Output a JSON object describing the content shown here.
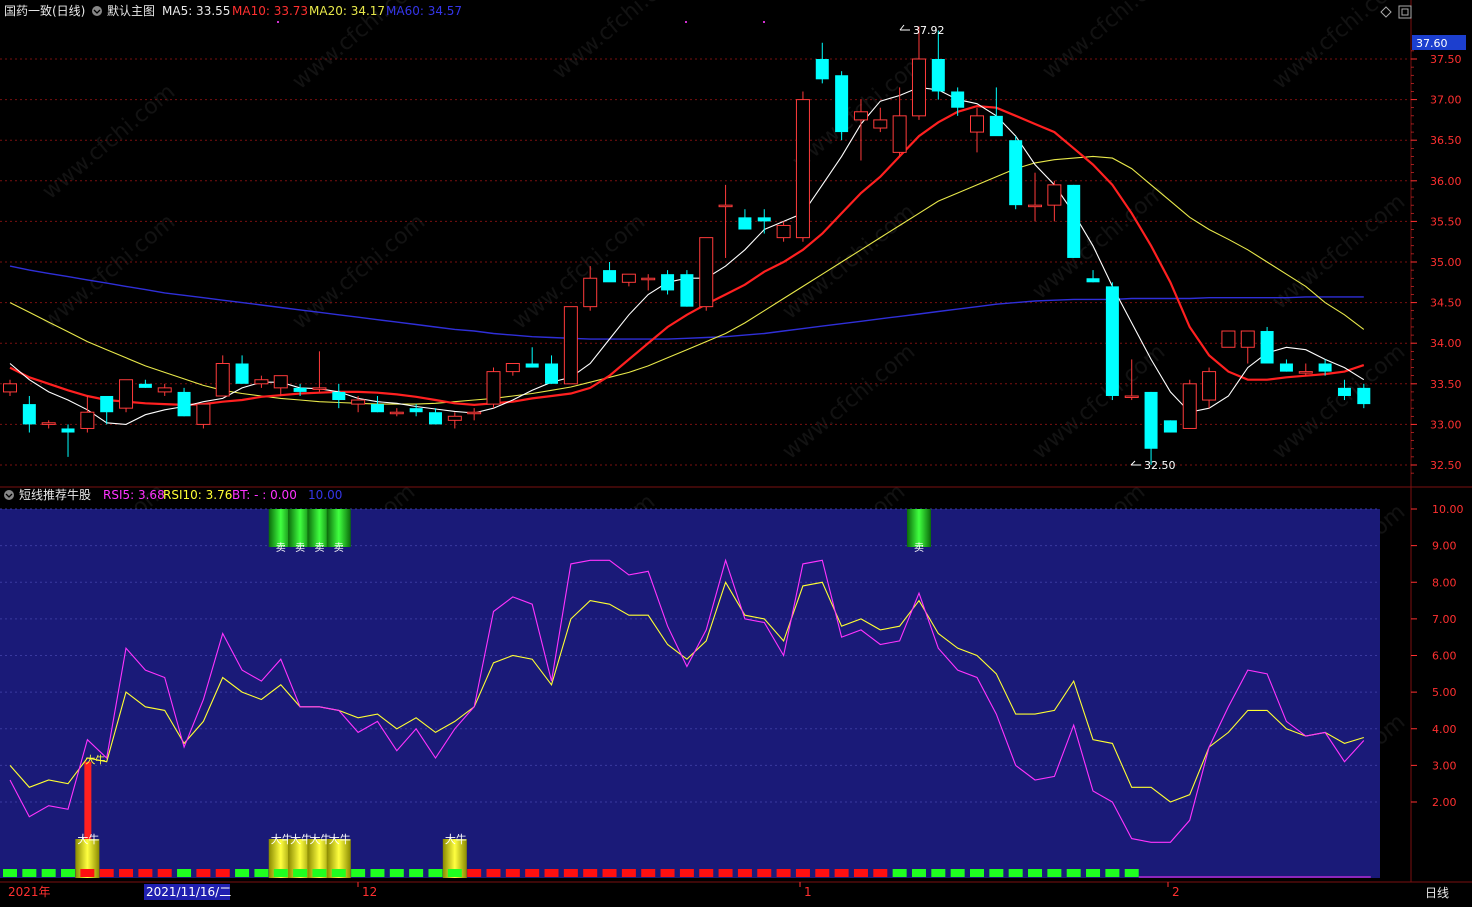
{
  "main_header": {
    "stock": "国药一致(日线)",
    "template": "默认主图",
    "ma5": "MA5: 33.55",
    "ma10": "MA10: 33.73",
    "ma20": "MA20: 34.17",
    "ma60": "MA60: 34.57"
  },
  "sub_header": {
    "indicator": "短线推荐牛股",
    "rsi5": "RSI5: 3.68",
    "rsi10": "RSI10: 3.76",
    "bt": "BT: - : 0.00",
    "ten": "10.00"
  },
  "price_label": "37.60",
  "high_marker": "37.92",
  "low_marker": "32.50",
  "bottom_axis": {
    "year": "2021年",
    "selected_date": "2021/11/16/二",
    "m12": "12",
    "m1": "1",
    "m2": "2",
    "period": "日线"
  },
  "signal_labels": {
    "sell": "卖",
    "bull": "大牛"
  },
  "watermark": "www.cfchi.com",
  "colors": {
    "up": "#ff3b3b",
    "down": "#00ffff",
    "ma5": "#ffffff",
    "ma10": "#ff2020",
    "ma20": "#e8e84a",
    "ma60": "#2f2fd8",
    "rsi5": "#ff33ff",
    "rsi10": "#ffff33",
    "panel_bg": "#1a1a78"
  },
  "chart_data": [
    {
      "type": "candlestick",
      "title": "国药一致(日线)",
      "ylim": [
        32.35,
        37.75
      ],
      "yticks": [
        32.5,
        33.0,
        33.5,
        34.0,
        34.5,
        35.0,
        35.5,
        36.0,
        36.5,
        37.0,
        37.5
      ],
      "ohlc": [
        [
          33.4,
          33.55,
          33.35,
          33.5
        ],
        [
          33.25,
          33.35,
          32.9,
          33.0
        ],
        [
          33.0,
          33.05,
          32.95,
          33.02
        ],
        [
          32.95,
          33.0,
          32.6,
          32.9
        ],
        [
          32.95,
          33.35,
          32.9,
          33.15
        ],
        [
          33.35,
          33.2,
          33.0,
          33.15
        ],
        [
          33.2,
          33.55,
          33.15,
          33.55
        ],
        [
          33.5,
          33.55,
          33.45,
          33.45
        ],
        [
          33.4,
          33.5,
          33.35,
          33.45
        ],
        [
          33.4,
          33.45,
          33.1,
          33.1
        ],
        [
          33.0,
          33.25,
          32.95,
          33.25
        ],
        [
          33.35,
          33.85,
          33.35,
          33.75
        ],
        [
          33.75,
          33.85,
          33.5,
          33.5
        ],
        [
          33.5,
          33.6,
          33.45,
          33.55
        ],
        [
          33.45,
          33.6,
          33.35,
          33.6
        ],
        [
          33.45,
          33.5,
          33.35,
          33.4
        ],
        [
          33.45,
          33.9,
          33.4,
          33.45
        ],
        [
          33.4,
          33.5,
          33.2,
          33.3
        ],
        [
          33.25,
          33.35,
          33.15,
          33.3
        ],
        [
          33.25,
          33.35,
          33.15,
          33.15
        ],
        [
          33.15,
          33.2,
          33.1,
          33.15
        ],
        [
          33.2,
          33.25,
          33.1,
          33.15
        ],
        [
          33.15,
          33.2,
          33.0,
          33.0
        ],
        [
          33.05,
          33.15,
          32.95,
          33.1
        ],
        [
          33.15,
          33.2,
          33.05,
          33.15
        ],
        [
          33.25,
          33.7,
          33.2,
          33.65
        ],
        [
          33.65,
          33.75,
          33.6,
          33.75
        ],
        [
          33.75,
          33.95,
          33.7,
          33.7
        ],
        [
          33.75,
          33.85,
          33.5,
          33.5
        ],
        [
          33.5,
          34.45,
          33.5,
          34.45
        ],
        [
          34.45,
          34.95,
          34.4,
          34.8
        ],
        [
          34.9,
          35.0,
          34.85,
          34.75
        ],
        [
          34.75,
          34.85,
          34.7,
          34.85
        ],
        [
          34.8,
          34.85,
          34.65,
          34.8
        ],
        [
          34.85,
          34.9,
          34.6,
          34.65
        ],
        [
          34.85,
          34.9,
          34.45,
          34.45
        ],
        [
          34.45,
          35.3,
          34.4,
          35.3
        ],
        [
          35.7,
          35.95,
          35.05,
          35.7
        ],
        [
          35.55,
          35.65,
          35.4,
          35.4
        ],
        [
          35.55,
          35.65,
          35.35,
          35.5
        ],
        [
          35.3,
          35.5,
          35.25,
          35.45
        ],
        [
          35.3,
          37.1,
          35.25,
          37.0
        ],
        [
          37.5,
          37.7,
          37.2,
          37.25
        ],
        [
          37.3,
          37.35,
          36.5,
          36.6
        ],
        [
          36.75,
          37.0,
          36.25,
          36.85
        ],
        [
          36.65,
          36.9,
          36.6,
          36.75
        ],
        [
          36.35,
          37.15,
          36.3,
          36.8
        ],
        [
          36.8,
          37.9,
          36.75,
          37.5
        ],
        [
          37.5,
          37.85,
          37.0,
          37.1
        ],
        [
          37.1,
          37.15,
          36.8,
          36.9
        ],
        [
          36.6,
          36.9,
          36.35,
          36.8
        ],
        [
          36.8,
          37.15,
          36.7,
          36.55
        ],
        [
          36.5,
          36.55,
          35.65,
          35.7
        ],
        [
          35.7,
          36.1,
          35.5,
          35.7
        ],
        [
          35.7,
          36.0,
          35.5,
          35.95
        ],
        [
          35.95,
          35.95,
          35.05,
          35.05
        ],
        [
          34.8,
          34.9,
          34.75,
          34.75
        ],
        [
          34.7,
          34.75,
          33.3,
          33.35
        ],
        [
          33.35,
          33.8,
          33.3,
          33.35
        ],
        [
          33.4,
          33.4,
          32.5,
          32.7
        ],
        [
          33.05,
          33.05,
          32.9,
          32.9
        ],
        [
          32.95,
          33.55,
          32.95,
          33.5
        ],
        [
          33.3,
          33.7,
          33.2,
          33.65
        ],
        [
          33.95,
          34.15,
          33.95,
          34.15
        ],
        [
          33.95,
          34.15,
          33.75,
          34.15
        ],
        [
          34.15,
          34.2,
          33.75,
          33.75
        ],
        [
          33.75,
          33.8,
          33.65,
          33.65
        ],
        [
          33.65,
          33.75,
          33.6,
          33.65
        ],
        [
          33.75,
          33.8,
          33.6,
          33.65
        ],
        [
          33.45,
          33.55,
          33.3,
          33.35
        ],
        [
          33.45,
          33.5,
          33.2,
          33.25
        ]
      ],
      "ma5": [
        33.75,
        33.55,
        33.4,
        33.3,
        33.18,
        33.02,
        33.0,
        33.12,
        33.18,
        33.22,
        33.28,
        33.32,
        33.45,
        33.52,
        33.52,
        33.45,
        33.44,
        33.4,
        33.32,
        33.28,
        33.26,
        33.22,
        33.19,
        33.16,
        33.14,
        33.2,
        33.3,
        33.42,
        33.52,
        33.58,
        33.75,
        34.05,
        34.35,
        34.6,
        34.75,
        34.8,
        34.8,
        34.95,
        35.15,
        35.4,
        35.5,
        35.6,
        35.95,
        36.3,
        36.7,
        36.98,
        37.05,
        37.15,
        37.12,
        37.0,
        36.95,
        36.8,
        36.55,
        36.2,
        35.95,
        35.6,
        35.2,
        34.7,
        34.25,
        33.8,
        33.4,
        33.15,
        33.2,
        33.35,
        33.7,
        33.88,
        33.95,
        33.92,
        33.8,
        33.7,
        33.55
      ],
      "ma10": [
        33.7,
        33.58,
        33.5,
        33.42,
        33.35,
        33.3,
        33.28,
        33.26,
        33.25,
        33.24,
        33.25,
        33.28,
        33.3,
        33.34,
        33.36,
        33.38,
        33.39,
        33.4,
        33.4,
        33.39,
        33.37,
        33.34,
        33.3,
        33.26,
        33.24,
        33.26,
        33.28,
        33.32,
        33.35,
        33.38,
        33.45,
        33.6,
        33.8,
        34.0,
        34.2,
        34.35,
        34.48,
        34.6,
        34.72,
        34.88,
        35.0,
        35.15,
        35.35,
        35.6,
        35.85,
        36.05,
        36.3,
        36.55,
        36.72,
        36.85,
        36.92,
        36.9,
        36.8,
        36.7,
        36.6,
        36.4,
        36.2,
        35.95,
        35.6,
        35.2,
        34.75,
        34.2,
        33.85,
        33.65,
        33.55,
        33.55,
        33.58,
        33.6,
        33.62,
        33.65,
        33.73
      ],
      "ma20": [
        34.5,
        34.38,
        34.26,
        34.14,
        34.02,
        33.92,
        33.82,
        33.72,
        33.64,
        33.56,
        33.48,
        33.42,
        33.38,
        33.35,
        33.32,
        33.3,
        33.28,
        33.27,
        33.26,
        33.25,
        33.25,
        33.25,
        33.26,
        33.28,
        33.3,
        33.32,
        33.35,
        33.38,
        33.42,
        33.46,
        33.52,
        33.58,
        33.64,
        33.72,
        33.82,
        33.92,
        34.02,
        34.12,
        34.25,
        34.4,
        34.55,
        34.7,
        34.85,
        35.0,
        35.15,
        35.3,
        35.45,
        35.6,
        35.75,
        35.85,
        35.95,
        36.05,
        36.15,
        36.22,
        36.26,
        36.28,
        36.3,
        36.28,
        36.15,
        35.95,
        35.75,
        35.55,
        35.4,
        35.28,
        35.15,
        35.0,
        34.85,
        34.7,
        34.5,
        34.35,
        34.17
      ],
      "ma60": [
        34.95,
        34.9,
        34.86,
        34.82,
        34.78,
        34.74,
        34.7,
        34.66,
        34.62,
        34.59,
        34.56,
        34.53,
        34.5,
        34.47,
        34.44,
        34.41,
        34.38,
        34.35,
        34.32,
        34.29,
        34.26,
        34.23,
        34.2,
        34.17,
        34.15,
        34.12,
        34.1,
        34.08,
        34.07,
        34.06,
        34.05,
        34.05,
        34.05,
        34.05,
        34.05,
        34.06,
        34.07,
        34.08,
        34.1,
        34.12,
        34.15,
        34.18,
        34.21,
        34.24,
        34.27,
        34.3,
        34.33,
        34.36,
        34.39,
        34.42,
        34.45,
        34.48,
        34.5,
        34.52,
        34.53,
        34.54,
        34.54,
        34.54,
        34.55,
        34.55,
        34.55,
        34.55,
        34.56,
        34.56,
        34.56,
        34.56,
        34.56,
        34.57,
        34.57,
        34.57,
        34.57
      ]
    },
    {
      "type": "line",
      "title": "短线推荐牛股",
      "ylim": [
        0.3,
        10.3
      ],
      "yticks": [
        2.0,
        3.0,
        4.0,
        5.0,
        6.0,
        7.0,
        8.0,
        9.0,
        10.0
      ],
      "series": [
        {
          "name": "RSI5",
          "values": [
            2.6,
            1.6,
            1.9,
            1.8,
            3.7,
            3.2,
            6.2,
            5.6,
            5.4,
            3.5,
            4.8,
            6.6,
            5.6,
            5.3,
            5.9,
            4.6,
            4.6,
            4.5,
            3.9,
            4.2,
            3.4,
            4.0,
            3.2,
            4.0,
            4.6,
            7.2,
            7.6,
            7.4,
            5.3,
            8.5,
            8.6,
            8.6,
            8.2,
            8.3,
            6.8,
            5.7,
            6.7,
            8.6,
            7.0,
            6.9,
            6.0,
            8.5,
            8.6,
            6.5,
            6.7,
            6.3,
            6.4,
            7.7,
            6.2,
            5.6,
            5.4,
            4.4,
            3.0,
            2.6,
            2.7,
            4.1,
            2.3,
            2.0,
            1.0,
            0.9,
            0.9,
            1.5,
            3.5,
            4.6,
            5.6,
            5.5,
            4.2,
            3.8,
            3.9,
            3.1,
            3.68
          ]
        },
        {
          "name": "RSI10",
          "values": [
            3.0,
            2.4,
            2.6,
            2.5,
            3.2,
            3.1,
            5.0,
            4.6,
            4.5,
            3.6,
            4.2,
            5.4,
            5.0,
            4.8,
            5.2,
            4.6,
            4.6,
            4.5,
            4.3,
            4.4,
            4.0,
            4.3,
            3.9,
            4.2,
            4.6,
            5.8,
            6.0,
            5.9,
            5.2,
            7.0,
            7.5,
            7.4,
            7.1,
            7.1,
            6.3,
            5.9,
            6.4,
            8.0,
            7.1,
            7.0,
            6.4,
            7.9,
            8.0,
            6.8,
            7.0,
            6.7,
            6.8,
            7.5,
            6.6,
            6.2,
            6.0,
            5.5,
            4.4,
            4.4,
            4.5,
            5.3,
            3.7,
            3.6,
            2.4,
            2.4,
            2.0,
            2.2,
            3.5,
            3.9,
            4.5,
            4.5,
            4.0,
            3.8,
            3.9,
            3.6,
            3.76
          ]
        }
      ],
      "sell_signals": [
        14,
        15,
        16,
        17,
        47
      ],
      "bull_signals": [
        4,
        14,
        15,
        16,
        17,
        23
      ],
      "tall_bar": 4
    }
  ]
}
